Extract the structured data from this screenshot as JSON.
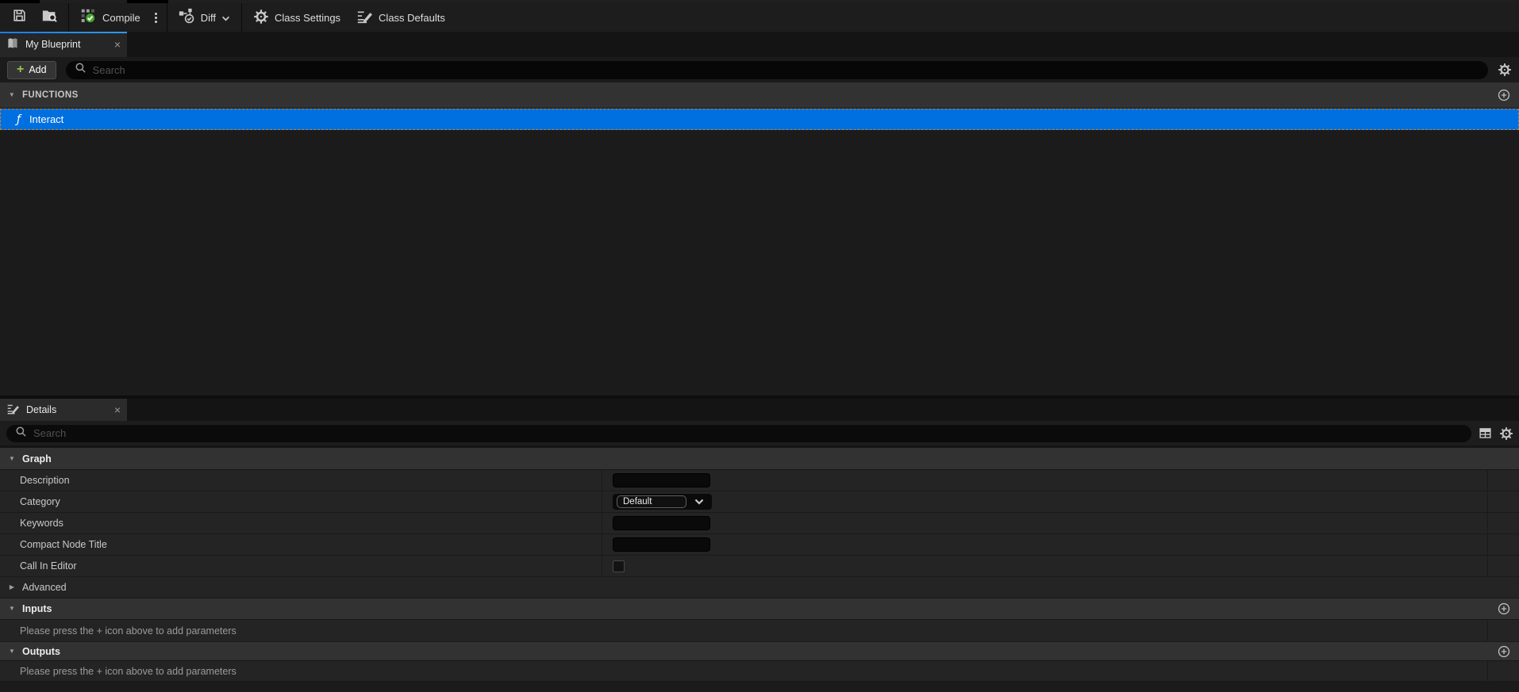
{
  "colors": {
    "selection_blue": "#0070E0",
    "tab_accent_blue": "#2D9BF0",
    "add_plus_green": "#95C14D",
    "compile_check_green": "#44A62C",
    "focus_dashed_orange": "#C87E33"
  },
  "toolbar": {
    "compile_label": "Compile",
    "diff_label": "Diff",
    "class_settings_label": "Class Settings",
    "class_defaults_label": "Class Defaults"
  },
  "my_blueprint": {
    "tab_title": "My Blueprint",
    "close_glyph": "×",
    "add_label": "Add",
    "add_plus_glyph": "+",
    "search_placeholder": "Search",
    "functions_section_label": "FUNCTIONS",
    "function_glyph": "ƒ",
    "functions": [
      {
        "name": "Interact",
        "selected": true
      }
    ]
  },
  "details": {
    "tab_title": "Details",
    "close_glyph": "×",
    "search_placeholder": "Search",
    "graph_section_label": "Graph",
    "properties": [
      {
        "label": "Description",
        "widget": "text-input",
        "value": ""
      },
      {
        "label": "Category",
        "widget": "combobox",
        "value": "Default"
      },
      {
        "label": "Keywords",
        "widget": "text-input",
        "value": ""
      },
      {
        "label": "Compact Node Title",
        "widget": "text-input",
        "value": ""
      },
      {
        "label": "Call In Editor",
        "widget": "checkbox",
        "checked": false
      }
    ],
    "advanced_label": "Advanced",
    "inputs_section_label": "Inputs",
    "outputs_section_label": "Outputs",
    "empty_parameters_text": "Please press the + icon above to add parameters"
  },
  "glyphs": {
    "caret_down": "▼",
    "caret_right": "▶"
  }
}
